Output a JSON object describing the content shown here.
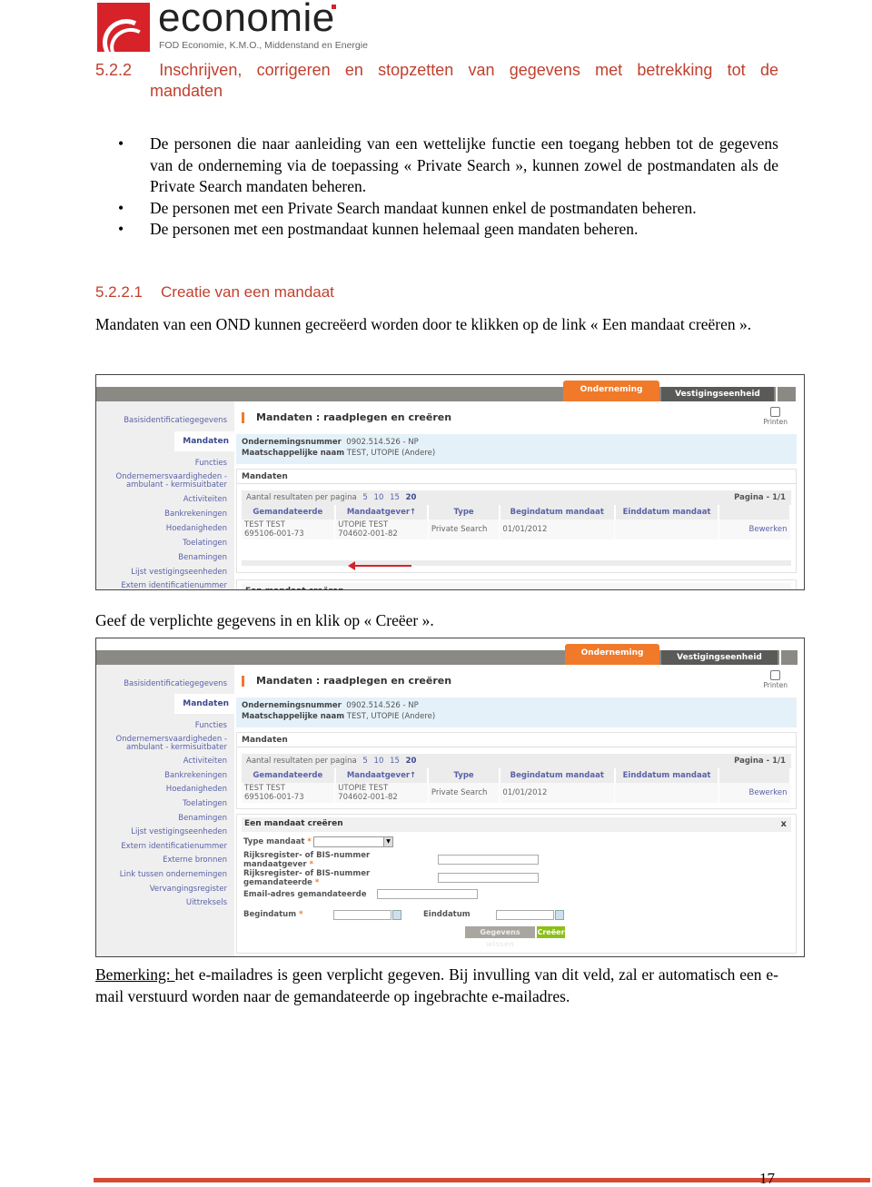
{
  "logo": {
    "wordmark": "economie",
    "subtitle": "FOD Economie, K.M.O., Middenstand en Energie",
    "brand_color": "#d7222a"
  },
  "section": {
    "number": "5.2.2",
    "title_line1_words": [
      "Inschrijven,",
      "corrigeren",
      "en",
      "stopzetten",
      "van",
      "gegevens",
      "met",
      "betrekking",
      "tot",
      "de"
    ],
    "title_line2": "mandaten",
    "heading_color": "#c0402e"
  },
  "bullets": [
    "De personen die naar aanleiding van een wettelijke functie een toegang hebben tot de gegevens van de onderneming via de toepassing « Private Search », kunnen zowel de postmandaten als de Private Search mandaten beheren.",
    "De personen met een Private Search mandaat kunnen enkel de postmandaten beheren.",
    "De personen met een postmandaat kunnen helemaal geen mandaten beheren."
  ],
  "subsection": {
    "number": "5.2.2.1",
    "title": "Creatie van een mandaat"
  },
  "paragraphs": {
    "intro": "Mandaten van een OND kunnen gecreëerd worden door te klikken op de link « Een mandaat creëren ».",
    "instruction": "Geef de verplichte gegevens in en klik op « Creëer ».",
    "remark_label": "Bemerking: ",
    "remark_text": "het e-mailadres is geen verplicht gegeven. Bij invulling van dit veld, zal er automatisch een e-mail verstuurd worden naar de gemandateerde op ingebrachte e-mailadres."
  },
  "app": {
    "tabs": {
      "active": "Onderneming",
      "other": "Vestigingseenheid",
      "active_color": "#f07a2a"
    },
    "sidebar_short": [
      "Basisidentificatiegegevens",
      "Mandaten",
      "Functies",
      "Ondernemersvaardigheden -",
      "ambulant - kermisuitbater",
      "Activiteiten",
      "Bankrekeningen",
      "Hoedanigheden",
      "Toelatingen",
      "Benamingen",
      "Lijst vestigingseenheden",
      "Extern identificatienummer"
    ],
    "sidebar_extra": [
      "Externe bronnen",
      "Link tussen ondernemingen",
      "Vervangingsregister",
      "Uittreksels"
    ],
    "page_title": "Mandaten : raadplegen en creëren",
    "print_label": "Printen",
    "info": {
      "number_label": "Ondernemingsnummer",
      "number_value": "0902.514.526  - NP",
      "name_label": "Maatschappelijke naam",
      "name_value": "TEST, UTOPIE (Andere)"
    },
    "mandates_panel": {
      "title": "Mandaten",
      "per_page_label": "Aantal resultaten per pagina",
      "per_page_options": [
        "5",
        "10",
        "15",
        "20"
      ],
      "selected_per_page": "20",
      "pagination": "Pagina - 1/1",
      "columns": [
        "Gemandateerde",
        "Mandaatgever↑",
        "Type",
        "Begindatum mandaat",
        "Einddatum mandaat",
        ""
      ],
      "rows": [
        {
          "gemandateerde_name": "TEST TEST",
          "gemandateerde_id": "695106-001-73",
          "mandaatgever_name": "UTOPIE TEST",
          "mandaatgever_id": "704602-001-82",
          "type": "Private Search",
          "begindatum": "01/01/2012",
          "einddatum": "",
          "action": "Bewerken"
        }
      ]
    },
    "create_link": "Een mandaat creëren",
    "form": {
      "title": "Een mandaat creëren",
      "close": "x",
      "type_label": "Type mandaat",
      "rr_giver_label_1": "Rijksregister- of BIS-nummer",
      "rr_giver_label_2": "mandaatgever",
      "rr_receiver_label_1": "Rijksregister- of BIS-nummer",
      "rr_receiver_label_2": "gemandateerde",
      "email_label": "Email-adres gemandateerde",
      "start_label": "Begindatum",
      "end_label": "Einddatum",
      "required_mark": "*",
      "type_value": "",
      "rr_giver_value": "",
      "rr_receiver_value": "",
      "email_value": "",
      "start_value": "",
      "end_value": "",
      "clear_button": "Gegevens wissen",
      "create_button": "Creëer",
      "create_button_color": "#8cbf1a"
    }
  },
  "page_number": "17"
}
